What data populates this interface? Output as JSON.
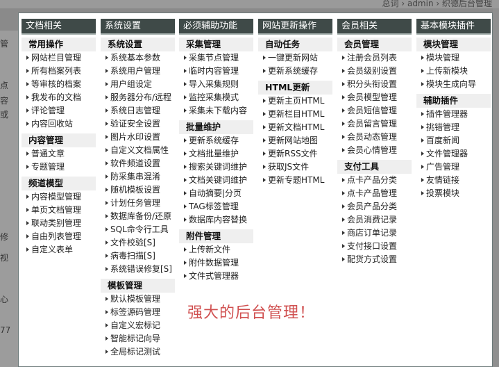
{
  "background": {
    "breadcrumb": "总词 › admin › 织德后台管理",
    "left_fragments": [
      "管",
      "点",
      "容",
      "或",
      "修",
      "视",
      "心",
      "77"
    ]
  },
  "columns": [
    {
      "header": "文档相关",
      "groups": [
        {
          "title": "常用操作",
          "items": [
            "网站栏目管理",
            "所有档案列表",
            "等审核的档案",
            "我发布的文档",
            "评论管理",
            "内容回收站"
          ]
        },
        {
          "title": "内容管理",
          "items": [
            "普通文章",
            "专题管理"
          ]
        },
        {
          "title": "频道模型",
          "items": [
            "内容模型管理",
            "单页文档管理",
            "联动类别管理",
            "自由列表管理",
            "自定义表单"
          ]
        }
      ]
    },
    {
      "header": "系统设置",
      "groups": [
        {
          "title": "系统设置",
          "items": [
            "系统基本参数",
            "系统用户管理",
            "用户组设定",
            "服务器分布/远程",
            "系统日志管理",
            "验证安全设置",
            "图片水印设置",
            "自定义文档属性",
            "软件频道设置",
            "防采集串混淆",
            "随机模板设置",
            "计划任务管理",
            "数据库备份/还原",
            "SQL命令行工具",
            "文件校验[S]",
            "病毒扫描[S]",
            "系统错误修复[S]"
          ]
        },
        {
          "title": "模板管理",
          "items": [
            "默认模板管理",
            "标签源码管理",
            "自定义宏标记",
            "智能标记向导",
            "全局标记测试"
          ]
        }
      ]
    },
    {
      "header": "必须辅助功能",
      "groups": [
        {
          "title": "采集管理",
          "items": [
            "采集节点管理",
            "临时内容管理",
            "导入采集规则",
            "监控采集模式",
            "采集未下载内容"
          ]
        },
        {
          "title": "批量维护",
          "items": [
            "更新系统缓存",
            "文档批量维护",
            "搜索关键词维护",
            "文档关键词维护",
            "自动摘要|分页",
            "TAG标签管理",
            "数据库内容替换"
          ]
        },
        {
          "title": "附件管理",
          "items": [
            "上传新文件",
            "附件数据管理",
            "文件式管理器"
          ]
        }
      ]
    },
    {
      "header": "网站更新操作",
      "groups": [
        {
          "title": "自动任务",
          "items": [
            "一键更新网站",
            "更新系统缓存"
          ]
        },
        {
          "title": "HTML更新",
          "items": [
            "更新主页HTML",
            "更新栏目HTML",
            "更新文档HTML",
            "更新网站地图",
            "更新RSS文件",
            "获取JS文件",
            "更新专题HTML"
          ]
        }
      ]
    },
    {
      "header": "会员相关",
      "groups": [
        {
          "title": "会员管理",
          "items": [
            "注册会员列表",
            "会员级别设置",
            "积分头衔设置",
            "会员模型管理",
            "会员短信管理",
            "会员留言管理",
            "会员动态管理",
            "会员心情管理"
          ]
        },
        {
          "title": "支付工具",
          "items": [
            "点卡产品分类",
            "点卡产品管理",
            "会员产品分类",
            "会员消费记录",
            "商店订单记录",
            "支付接口设置",
            "配货方式设置"
          ]
        }
      ]
    },
    {
      "header": "基本模块插件",
      "groups": [
        {
          "title": "模块管理",
          "items": [
            "模块管理",
            "上传新模块",
            "模块生成向导"
          ]
        },
        {
          "title": "辅助插件",
          "items": [
            "插件管理器",
            "挑错管理",
            "百度新闻",
            "文件管理器",
            "广告管理",
            "友情链接",
            "投票模块"
          ]
        }
      ]
    }
  ],
  "slogan": "强大的后台管理！"
}
